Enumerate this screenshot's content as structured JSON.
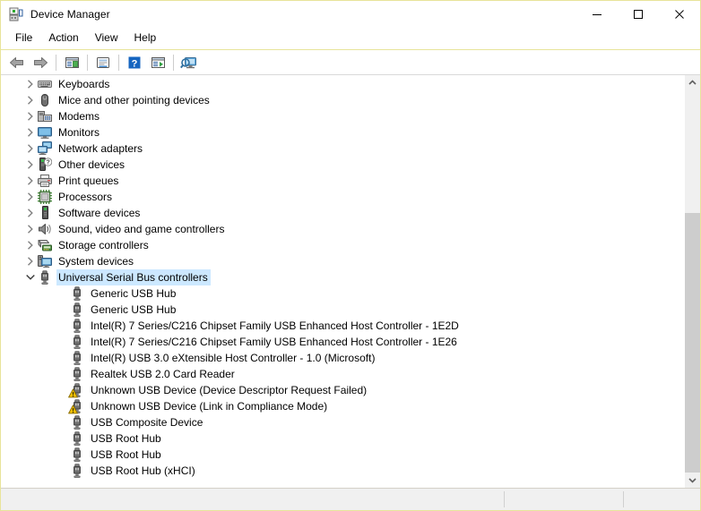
{
  "window": {
    "title": "Device Manager",
    "icon": "device-manager-icon",
    "border_color": "#e8e49a",
    "controls": [
      {
        "name": "minimize-button",
        "glyph": "minimize"
      },
      {
        "name": "maximize-button",
        "glyph": "maximize"
      },
      {
        "name": "close-button",
        "glyph": "close"
      }
    ]
  },
  "menubar": {
    "items": [
      {
        "label": "File"
      },
      {
        "label": "Action"
      },
      {
        "label": "View"
      },
      {
        "label": "Help"
      }
    ]
  },
  "toolbar": {
    "buttons": [
      {
        "name": "back-button",
        "icon": "left-arrow-icon"
      },
      {
        "name": "forward-button",
        "icon": "right-arrow-icon"
      },
      {
        "name": "separator-1",
        "icon": "separator"
      },
      {
        "name": "show-hide-console-tree-button",
        "icon": "console-tree-icon"
      },
      {
        "name": "separator-2",
        "icon": "separator"
      },
      {
        "name": "properties-button",
        "icon": "properties-icon"
      },
      {
        "name": "separator-3",
        "icon": "separator"
      },
      {
        "name": "help-button",
        "icon": "question-mark-icon"
      },
      {
        "name": "update-driver-button",
        "icon": "update-driver-icon"
      },
      {
        "name": "separator-4",
        "icon": "separator"
      },
      {
        "name": "scan-for-hardware-changes-button",
        "icon": "scan-hardware-icon"
      }
    ]
  },
  "tree": {
    "selected_label": "Universal Serial Bus controllers",
    "selection_color": "#cce8ff",
    "rows": [
      {
        "label": "Keyboards",
        "level": 1,
        "expander": "collapsed",
        "icon": "keyboard-icon",
        "warning": false
      },
      {
        "label": "Mice and other pointing devices",
        "level": 1,
        "expander": "collapsed",
        "icon": "mouse-icon",
        "warning": false
      },
      {
        "label": "Modems",
        "level": 1,
        "expander": "collapsed",
        "icon": "modem-icon",
        "warning": false
      },
      {
        "label": "Monitors",
        "level": 1,
        "expander": "collapsed",
        "icon": "monitor-icon",
        "warning": false
      },
      {
        "label": "Network adapters",
        "level": 1,
        "expander": "collapsed",
        "icon": "network-adapter-icon",
        "warning": false
      },
      {
        "label": "Other devices",
        "level": 1,
        "expander": "collapsed",
        "icon": "other-device-icon",
        "warning": false
      },
      {
        "label": "Print queues",
        "level": 1,
        "expander": "collapsed",
        "icon": "printer-icon",
        "warning": false
      },
      {
        "label": "Processors",
        "level": 1,
        "expander": "collapsed",
        "icon": "processor-icon",
        "warning": false
      },
      {
        "label": "Software devices",
        "level": 1,
        "expander": "collapsed",
        "icon": "software-device-icon",
        "warning": false
      },
      {
        "label": "Sound, video and game controllers",
        "level": 1,
        "expander": "collapsed",
        "icon": "speaker-icon",
        "warning": false
      },
      {
        "label": "Storage controllers",
        "level": 1,
        "expander": "collapsed",
        "icon": "storage-controller-icon",
        "warning": false
      },
      {
        "label": "System devices",
        "level": 1,
        "expander": "collapsed",
        "icon": "system-device-icon",
        "warning": false
      },
      {
        "label": "Universal Serial Bus controllers",
        "level": 1,
        "expander": "expanded",
        "icon": "usb-icon",
        "warning": false,
        "selected": true
      },
      {
        "label": "Generic USB Hub",
        "level": 2,
        "expander": "none",
        "icon": "usb-icon",
        "warning": false
      },
      {
        "label": "Generic USB Hub",
        "level": 2,
        "expander": "none",
        "icon": "usb-icon",
        "warning": false
      },
      {
        "label": "Intel(R) 7 Series/C216 Chipset Family USB Enhanced Host Controller - 1E2D",
        "level": 2,
        "expander": "none",
        "icon": "usb-icon",
        "warning": false
      },
      {
        "label": "Intel(R) 7 Series/C216 Chipset Family USB Enhanced Host Controller - 1E26",
        "level": 2,
        "expander": "none",
        "icon": "usb-icon",
        "warning": false
      },
      {
        "label": "Intel(R) USB 3.0 eXtensible Host Controller - 1.0 (Microsoft)",
        "level": 2,
        "expander": "none",
        "icon": "usb-icon",
        "warning": false
      },
      {
        "label": "Realtek USB 2.0 Card Reader",
        "level": 2,
        "expander": "none",
        "icon": "usb-icon",
        "warning": false
      },
      {
        "label": "Unknown USB Device (Device Descriptor Request Failed)",
        "level": 2,
        "expander": "none",
        "icon": "usb-icon",
        "warning": true
      },
      {
        "label": "Unknown USB Device (Link in Compliance Mode)",
        "level": 2,
        "expander": "none",
        "icon": "usb-icon",
        "warning": true
      },
      {
        "label": "USB Composite Device",
        "level": 2,
        "expander": "none",
        "icon": "usb-icon",
        "warning": false
      },
      {
        "label": "USB Root Hub",
        "level": 2,
        "expander": "none",
        "icon": "usb-icon",
        "warning": false
      },
      {
        "label": "USB Root Hub",
        "level": 2,
        "expander": "none",
        "icon": "usb-icon",
        "warning": false
      },
      {
        "label": "USB Root Hub (xHCI)",
        "level": 2,
        "expander": "none",
        "icon": "usb-icon",
        "warning": false
      }
    ]
  },
  "scrollbar": {
    "up_arrow": "scroll-up-arrow-icon",
    "down_arrow": "scroll-down-arrow-icon",
    "thumb_top_pct": 32,
    "thumb_height_pct": 68,
    "thumb_color": "#cdcdcd",
    "track_color": "#f0f0f0"
  },
  "statusbar": {
    "panes": [
      {
        "text": ""
      },
      {
        "text": ""
      },
      {
        "text": ""
      }
    ]
  }
}
